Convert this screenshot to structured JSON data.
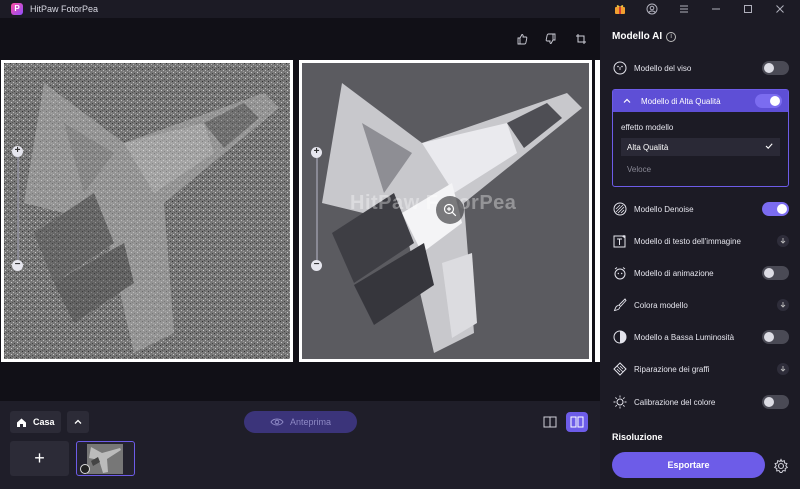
{
  "app": {
    "title": "HitPaw FotorPea",
    "logo_letter": "P"
  },
  "watermark": "HitPaw FotorPea",
  "bottom": {
    "home_label": "Casa",
    "preview_label": "Anteprima",
    "add_symbol": "+"
  },
  "side": {
    "title": "Modello AI",
    "info_symbol": "i",
    "models": [
      {
        "label": "Modello del viso",
        "control": "toggle",
        "on": false
      },
      {
        "label": "Modello di Alta Qualità",
        "control": "toggle",
        "on": true,
        "expanded": true
      },
      {
        "label": "Modello Denoise",
        "control": "toggle",
        "on": true
      },
      {
        "label": "Modello di testo dell'immagine",
        "control": "download"
      },
      {
        "label": "Modello di animazione",
        "control": "toggle",
        "on": false
      },
      {
        "label": "Colora modello",
        "control": "download"
      },
      {
        "label": "Modello a Bassa Luminosità",
        "control": "toggle",
        "on": false
      },
      {
        "label": "Riparazione dei graffi",
        "control": "download"
      },
      {
        "label": "Calibrazione del colore",
        "control": "toggle",
        "on": false
      }
    ],
    "effect": {
      "label": "effetto modello",
      "options": [
        "Alta Qualità",
        "Veloce"
      ],
      "selected": "Alta Qualità"
    },
    "resolution_label": "Risoluzione",
    "export_label": "Esportare"
  },
  "colors": {
    "accent": "#6d5ce8",
    "panel": "#1c1b25",
    "canvas": "#111017"
  }
}
